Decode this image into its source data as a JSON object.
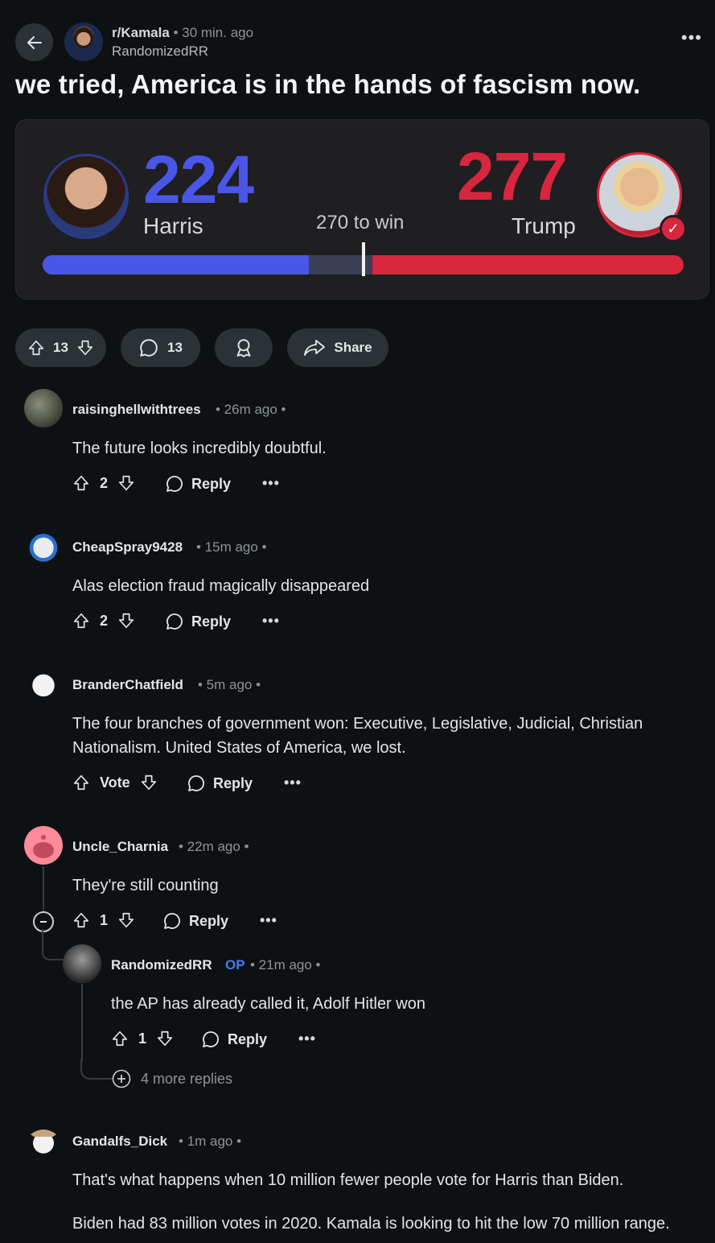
{
  "header": {
    "subreddit": "r/Kamala",
    "post_time": "• 30 min. ago",
    "author": "RandomizedRR",
    "more": "•••"
  },
  "post": {
    "title": "we tried, America is in the hands of fascism now.",
    "image": {
      "harris_votes": "224",
      "harris_name": "Harris",
      "trump_votes": "277",
      "trump_name": "Trump",
      "to_win": "270 to win",
      "harris_share": 0.415,
      "trump_share": 0.485,
      "colors": {
        "harris": "#4a56e8",
        "trump": "#d7263d"
      }
    },
    "actions": {
      "upvotes": "13",
      "comments": "13",
      "share": "Share"
    }
  },
  "comments": [
    {
      "user": "raisinghellwithtrees",
      "time": "• 26m ago •",
      "body": "The future looks incredibly doubtful.",
      "votes": "2",
      "reply": "Reply",
      "more": "•••"
    },
    {
      "user": "CheapSpray9428",
      "time": "• 15m ago •",
      "body": "Alas election fraud magically disappeared",
      "votes": "2",
      "reply": "Reply",
      "more": "•••"
    },
    {
      "user": "BranderChatfield",
      "time": "• 5m ago •",
      "body": "The four branches of government won: Executive, Legislative, Judicial, Christian Nationalism. United States of America, we lost.",
      "votes": "Vote",
      "reply": "Reply",
      "more": "•••"
    },
    {
      "user": "Uncle_Charnia",
      "time": "• 22m ago •",
      "body": "They're still counting",
      "votes": "1",
      "reply": "Reply",
      "more": "•••"
    },
    {
      "user": "RandomizedRR",
      "op": "OP",
      "time": "• 21m ago •",
      "body": "the AP has already called it, Adolf Hitler won",
      "votes": "1",
      "reply": "Reply",
      "more": "•••",
      "more_replies": "4 more replies"
    },
    {
      "user": "Gandalfs_Dick",
      "time": "• 1m ago •",
      "body": "That's what happens when 10 million fewer people vote for Harris than Biden.",
      "body2": "Biden had 83 million votes in 2020. Kamala is looking to hit the low 70 million range."
    }
  ]
}
